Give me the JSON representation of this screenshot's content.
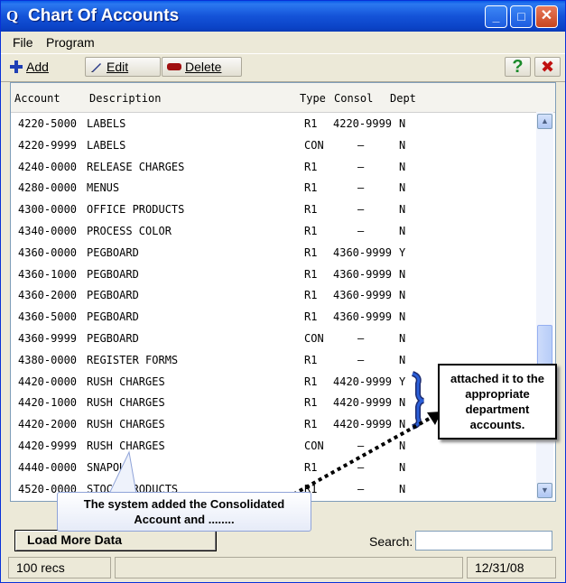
{
  "window": {
    "title": "Chart Of Accounts",
    "app_icon": "Q",
    "buttons": {
      "minimize": "_",
      "maximize": "□",
      "close": "✕"
    }
  },
  "menu": {
    "items": [
      "File",
      "Program"
    ]
  },
  "toolbar": {
    "add_label": "Add",
    "edit_label": "Edit",
    "delete_label": "Delete",
    "help_glyph": "?",
    "close_glyph": "✖"
  },
  "grid": {
    "columns": [
      "Account",
      "Description",
      "Type",
      "Consol",
      "Dept"
    ],
    "rows": [
      {
        "account": "4220-5000",
        "description": "LABELS",
        "type": "R1",
        "consol": "4220-9999",
        "dept": "N"
      },
      {
        "account": "4220-9999",
        "description": "LABELS",
        "type": "CON",
        "consol": "–",
        "dept": "N"
      },
      {
        "account": "4240-0000",
        "description": "RELEASE CHARGES",
        "type": "R1",
        "consol": "–",
        "dept": "N"
      },
      {
        "account": "4280-0000",
        "description": "MENUS",
        "type": "R1",
        "consol": "–",
        "dept": "N"
      },
      {
        "account": "4300-0000",
        "description": "OFFICE PRODUCTS",
        "type": "R1",
        "consol": "–",
        "dept": "N"
      },
      {
        "account": "4340-0000",
        "description": "PROCESS COLOR",
        "type": "R1",
        "consol": "–",
        "dept": "N"
      },
      {
        "account": "4360-0000",
        "description": "PEGBOARD",
        "type": "R1",
        "consol": "4360-9999",
        "dept": "Y"
      },
      {
        "account": "4360-1000",
        "description": "PEGBOARD",
        "type": "R1",
        "consol": "4360-9999",
        "dept": "N"
      },
      {
        "account": "4360-2000",
        "description": "PEGBOARD",
        "type": "R1",
        "consol": "4360-9999",
        "dept": "N"
      },
      {
        "account": "4360-5000",
        "description": "PEGBOARD",
        "type": "R1",
        "consol": "4360-9999",
        "dept": "N"
      },
      {
        "account": "4360-9999",
        "description": "PEGBOARD",
        "type": "CON",
        "consol": "–",
        "dept": "N"
      },
      {
        "account": "4380-0000",
        "description": "REGISTER FORMS",
        "type": "R1",
        "consol": "–",
        "dept": "N"
      },
      {
        "account": "4420-0000",
        "description": "RUSH CHARGES",
        "type": "R1",
        "consol": "4420-9999",
        "dept": "Y"
      },
      {
        "account": "4420-1000",
        "description": "RUSH CHARGES",
        "type": "R1",
        "consol": "4420-9999",
        "dept": "N"
      },
      {
        "account": "4420-2000",
        "description": "RUSH CHARGES",
        "type": "R1",
        "consol": "4420-9999",
        "dept": "N"
      },
      {
        "account": "4420-9999",
        "description": "RUSH CHARGES",
        "type": "CON",
        "consol": "–",
        "dept": "N"
      },
      {
        "account": "4440-0000",
        "description": "SNAPOU",
        "type": "R1",
        "consol": "–",
        "dept": "N"
      },
      {
        "account": "4520-0000",
        "description": "STOCK PRODUCTS",
        "type": "R1",
        "consol": "–",
        "dept": "N"
      }
    ]
  },
  "footer": {
    "load_more_label": "Load More Data",
    "search_label": "Search:",
    "search_value": "",
    "status_count": "100 recs",
    "status_date": "12/31/08"
  },
  "callouts": {
    "right_text": [
      "attached it to the",
      "appropriate",
      "department",
      "accounts."
    ],
    "bubble_text": [
      "The system added the Consolidated",
      "Account and ........"
    ]
  },
  "colors": {
    "titlebar": "#0a5ce8",
    "arrow": "#000000",
    "bracket": "#2b5fd8"
  }
}
